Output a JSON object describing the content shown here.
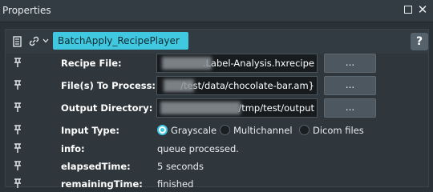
{
  "window": {
    "title": "Properties"
  },
  "module": {
    "name": "BatchApply_RecipePlayer",
    "help_label": "?"
  },
  "params": {
    "recipe_file": {
      "label": "Recipe File:",
      "value": ".Label-Analysis.hxrecipe",
      "button": "..."
    },
    "files_to_process": {
      "label": "File(s) To Process:",
      "value": "/test/data/chocolate-bar.am}",
      "button": "..."
    },
    "output_directory": {
      "label": "Output Directory:",
      "value": "/tmp/test/output",
      "button": "..."
    },
    "input_type": {
      "label": "Input Type:",
      "options": [
        "Grayscale",
        "Multichannel",
        "Dicom files"
      ],
      "selected": "Grayscale"
    },
    "info": {
      "label": "info:",
      "value": "queue processed."
    },
    "elapsed": {
      "label": "elapsedTime:",
      "value": "5 seconds"
    },
    "remaining": {
      "label": "remainingTime:",
      "value": "finished"
    }
  },
  "colors": {
    "accent": "#3fc8e0",
    "background": "#2a3238",
    "panel": "#2f373d"
  },
  "icons": [
    "pin-icon",
    "module-icon",
    "link-icon",
    "chevron-down-icon",
    "float-icon",
    "close-icon"
  ]
}
